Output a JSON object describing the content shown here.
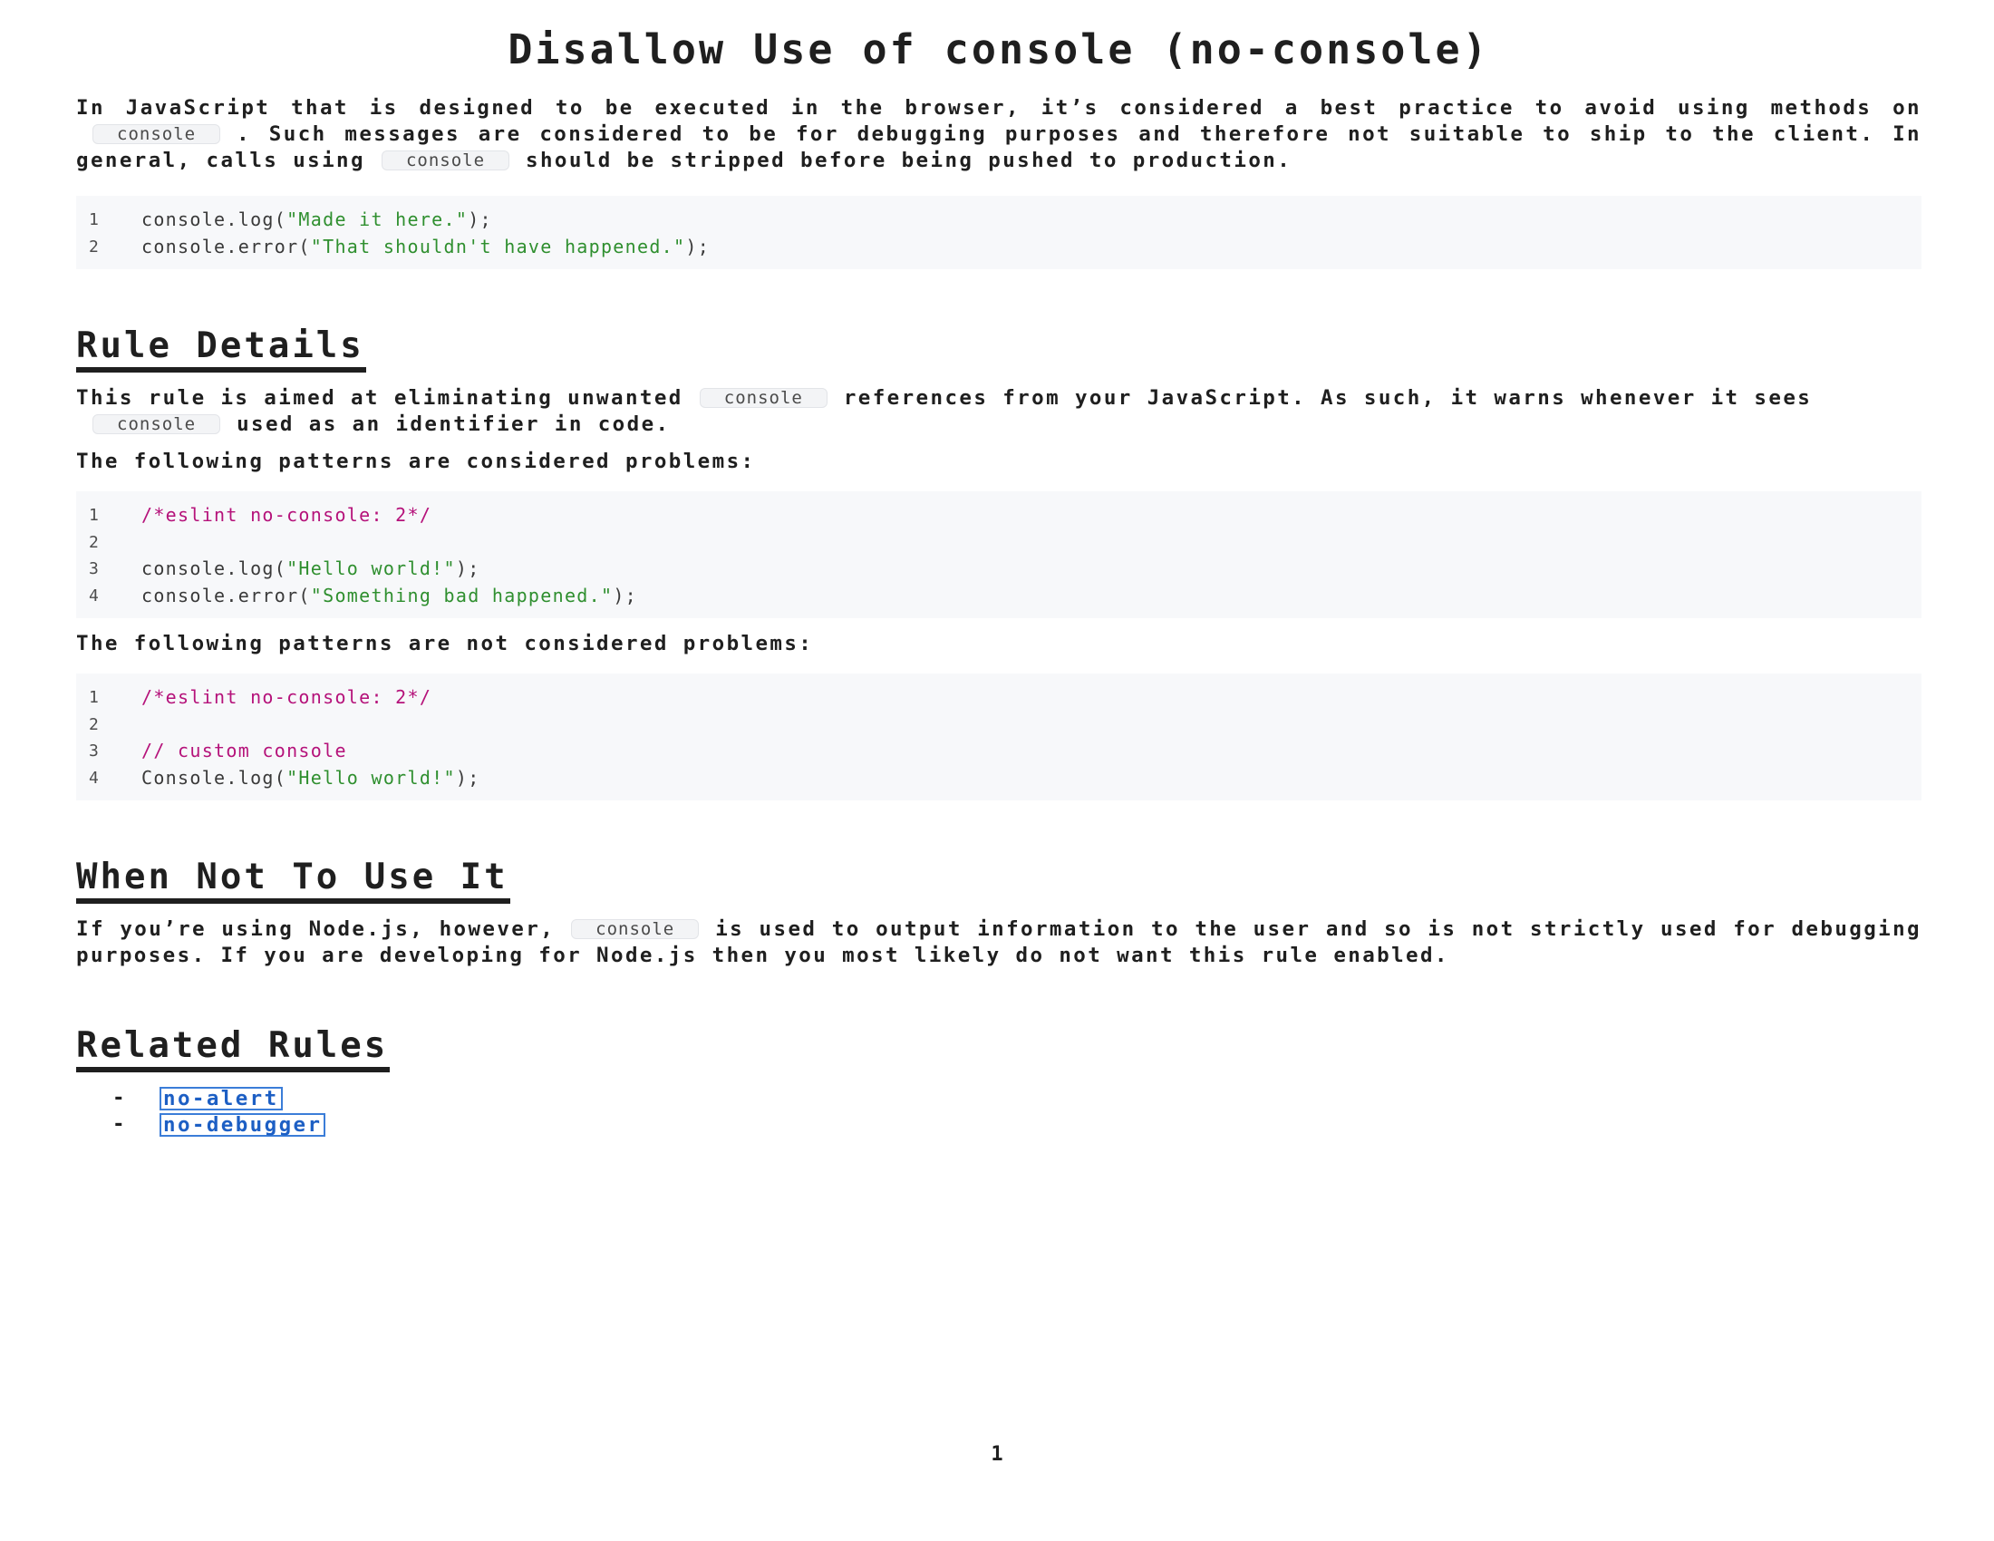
{
  "title": "Disallow Use of console (no-console)",
  "intro": {
    "part1": "In JavaScript that is designed to be executed in the browser, it’s considered a best practice to avoid using methods on",
    "code1": "console",
    "part2": ". Such messages are considered to be for debugging purposes and therefore not suitable to ship to the client. In general, calls using",
    "code2": "console",
    "part3": "should be stripped before being pushed to production."
  },
  "intro_code": {
    "lines": [
      {
        "num": "1",
        "pre": "console.log(",
        "str": "\"Made it here.\"",
        "post": ");"
      },
      {
        "num": "2",
        "pre": "console.error(",
        "str": "\"That shouldn't have happened.\"",
        "post": ");"
      }
    ]
  },
  "rule_details": {
    "heading": "Rule Details",
    "para1": {
      "part1": "This rule is aimed at eliminating unwanted",
      "code1": "console",
      "part2": "references from your JavaScript. As such, it warns whenever it sees",
      "code2": "console",
      "part3": "used as an identifier in code."
    },
    "problems_label": "The following patterns are considered problems:",
    "problems_code": {
      "l1_num": "1",
      "l1_cmt": "/*eslint no-console: 2*/",
      "l2_num": "2",
      "l3_num": "3",
      "l3_pre": "console.log(",
      "l3_str": "\"Hello world!\"",
      "l3_post": ");",
      "l4_num": "4",
      "l4_pre": "console.error(",
      "l4_str": "\"Something bad happened.\"",
      "l4_post": ");"
    },
    "not_problems_label": "The following patterns are not considered problems:",
    "not_problems_code": {
      "l1_num": "1",
      "l1_cmt": "/*eslint no-console: 2*/",
      "l2_num": "2",
      "l3_num": "3",
      "l3_cmt": "// custom console",
      "l4_num": "4",
      "l4_pre": "Console.log(",
      "l4_str": "\"Hello world!\"",
      "l4_post": ");"
    }
  },
  "when_not": {
    "heading": "When Not To Use It",
    "part1": "If you’re using Node.js, however,",
    "code1": "console",
    "part2": "is used to output information to the user and so is not strictly used for debugging purposes. If you are developing for Node.js then you most likely do not want this rule enabled."
  },
  "related": {
    "heading": "Related Rules",
    "bullet": "-",
    "items": [
      "no-alert",
      "no-debugger"
    ]
  },
  "page_number": "1",
  "colors": {
    "string": "#2f8f2f",
    "comment": "#b5127a",
    "link": "#1d5fc4",
    "code_bg": "#f7f8fa"
  }
}
